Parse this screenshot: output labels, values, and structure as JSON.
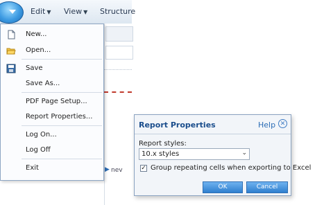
{
  "ribbon": {
    "app_button_icon": "chevron-down-icon",
    "menus": [
      {
        "label": "Edit"
      },
      {
        "label": "View"
      },
      {
        "label": "Structure"
      }
    ]
  },
  "file_menu": {
    "items": [
      {
        "label": "New...",
        "icon": "new-document-icon"
      },
      {
        "label": "Open...",
        "icon": "open-folder-icon"
      },
      {
        "label": "Save",
        "icon": "save-disk-icon"
      },
      {
        "label": "Save As...",
        "icon": ""
      },
      {
        "label": "PDF Page Setup...",
        "icon": ""
      },
      {
        "label": "Report Properties...",
        "icon": ""
      },
      {
        "label": "Log On...",
        "icon": ""
      },
      {
        "label": "Log Off",
        "icon": ""
      },
      {
        "label": "Exit",
        "icon": ""
      }
    ]
  },
  "background": {
    "partial_text": "nev"
  },
  "dialog": {
    "title": "Report Properties",
    "help_label": "Help",
    "close_icon": "close-circle-icon",
    "report_styles_label": "Report styles:",
    "report_styles_value": "10.x styles",
    "group_repeating_cells_checked": true,
    "group_repeating_cells_label": "Group repeating cells when exporting to Excel",
    "ok_label": "OK",
    "cancel_label": "Cancel"
  },
  "colors": {
    "accent": "#2f7fcf",
    "title_text": "#1a4d8c",
    "menu_border": "#8ea6c3"
  }
}
